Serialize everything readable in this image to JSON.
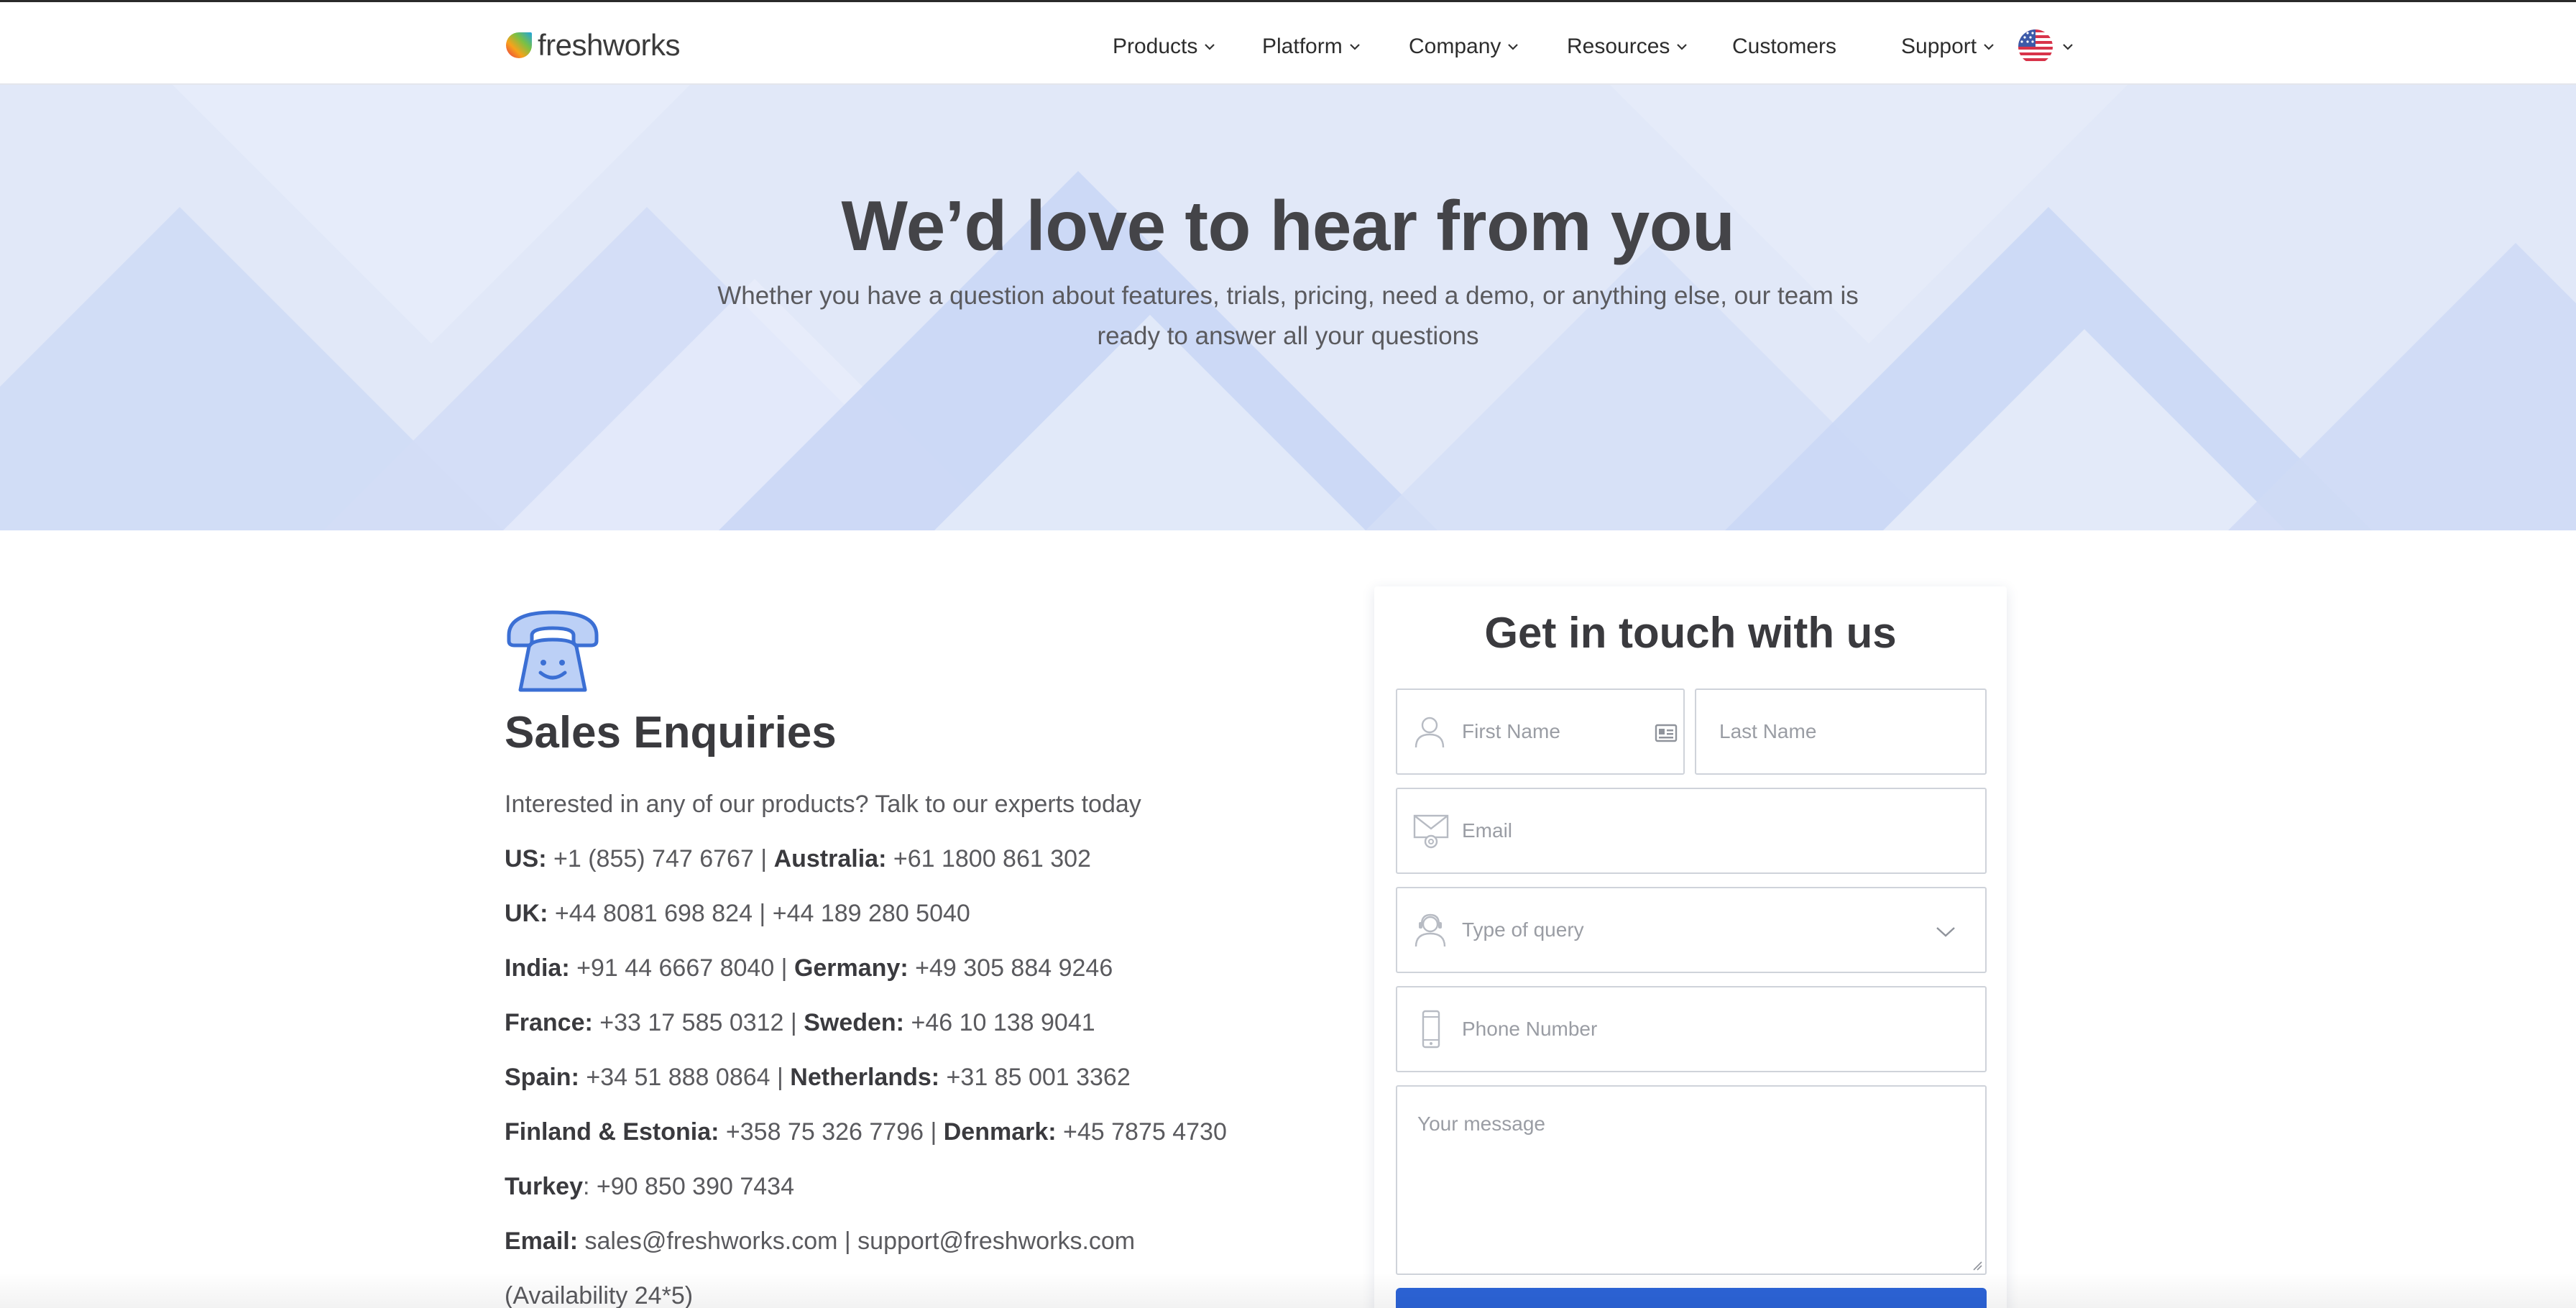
{
  "header": {
    "logo_text": "freshworks",
    "nav": [
      {
        "label": "Products",
        "has_dropdown": true
      },
      {
        "label": "Platform",
        "has_dropdown": true
      },
      {
        "label": "Company",
        "has_dropdown": true
      },
      {
        "label": "Resources",
        "has_dropdown": true
      },
      {
        "label": "Customers",
        "has_dropdown": false
      },
      {
        "label": "Support",
        "has_dropdown": true
      }
    ],
    "locale_icon": "us-flag-icon"
  },
  "hero": {
    "title": "We’d love to hear from you",
    "subtitle_line1": "Whether you have a question about features, trials, pricing, need a demo, or anything else, our team is",
    "subtitle_line2": "ready to answer all your questions"
  },
  "sales": {
    "icon": "telephone-icon",
    "title": "Sales Enquiries",
    "intro": "Interested in any of our products? Talk to our experts today",
    "lines": [
      [
        {
          "label": "US:",
          "value": " +1 (855) 747 6767 | "
        },
        {
          "label": "Australia:",
          "value": " +61 1800 861 302"
        }
      ],
      [
        {
          "label": "UK:",
          "value": " +44 8081 698 824 | +44 189 280 5040"
        }
      ],
      [
        {
          "label": "India:",
          "value": " +91 44 6667 8040 | "
        },
        {
          "label": "Germany:",
          "value": " +49 305 884 9246"
        }
      ],
      [
        {
          "label": "France:",
          "value": " +33 17 585 0312 | "
        },
        {
          "label": "Sweden:",
          "value": " +46 10 138 9041"
        }
      ],
      [
        {
          "label": "Spain:",
          "value": " +34 51 888 0864 | "
        },
        {
          "label": "Netherlands:",
          "value": " +31 85 001 3362"
        }
      ],
      [
        {
          "label": "Finland & Estonia:",
          "value": " +358 75 326 7796 | "
        },
        {
          "label": "Denmark:",
          "value": " +45 7875 4730"
        }
      ],
      [
        {
          "label": "Turkey",
          "value": ": +90 850 390 7434"
        }
      ],
      [
        {
          "label": "Email:",
          "value": " sales@freshworks.com | support@freshworks.com"
        }
      ]
    ],
    "availability": "(Availability 24*5)"
  },
  "form": {
    "title": "Get in touch with us",
    "first_name_placeholder": "First Name",
    "last_name_placeholder": "Last Name",
    "email_placeholder": "Email",
    "query_placeholder": "Type of query",
    "phone_placeholder": "Phone Number",
    "message_placeholder": "Your message",
    "submit_color": "#2c64d8"
  },
  "colors": {
    "hero_bg": "#dde5f8",
    "accent_blue": "#3b6fd4",
    "text_dark": "#3a3a3e"
  }
}
